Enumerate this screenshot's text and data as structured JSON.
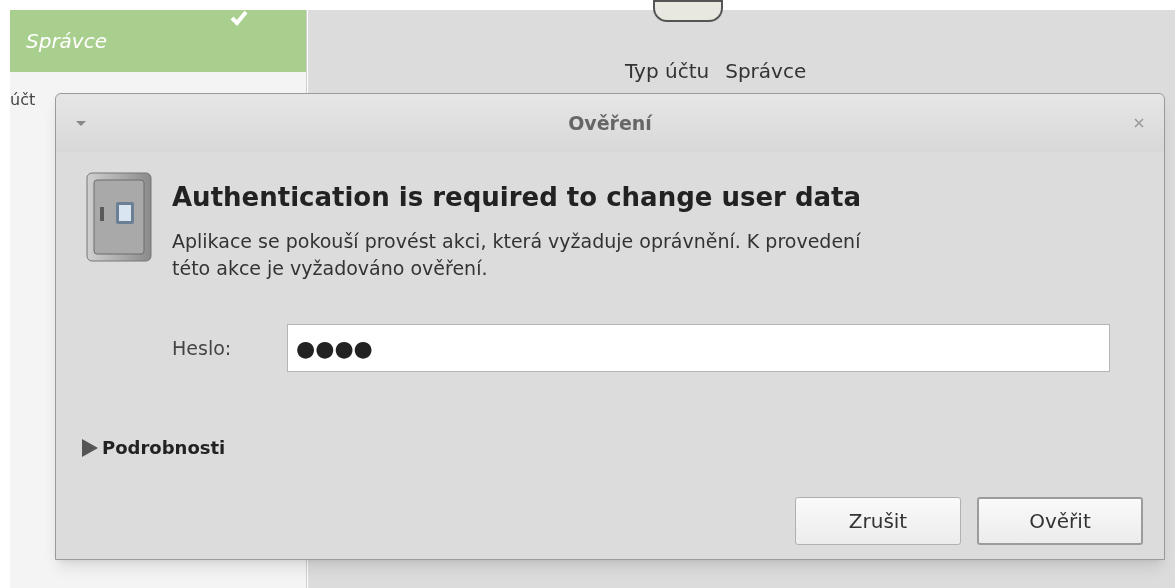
{
  "background": {
    "sidebar": {
      "items": [
        {
          "name": "Správce",
          "selected": true,
          "checked": true
        }
      ],
      "partial_label": "účt"
    },
    "details": {
      "account_type_label": "Typ účtu",
      "account_type_value": "Správce"
    }
  },
  "dialog": {
    "title": "Ověření",
    "heading": "Authentication is required to change user data",
    "message": "Aplikace se pokouší provést akci, která vyžaduje oprávnění. K provedení této akce je vyžadováno ověření.",
    "password": {
      "label": "Heslo:",
      "value": "●●●●"
    },
    "details": {
      "label": "Podrobnosti",
      "expanded": false
    },
    "buttons": [
      {
        "label": "Zrušit",
        "default": false
      },
      {
        "label": "Ověřit",
        "default": true
      }
    ]
  }
}
